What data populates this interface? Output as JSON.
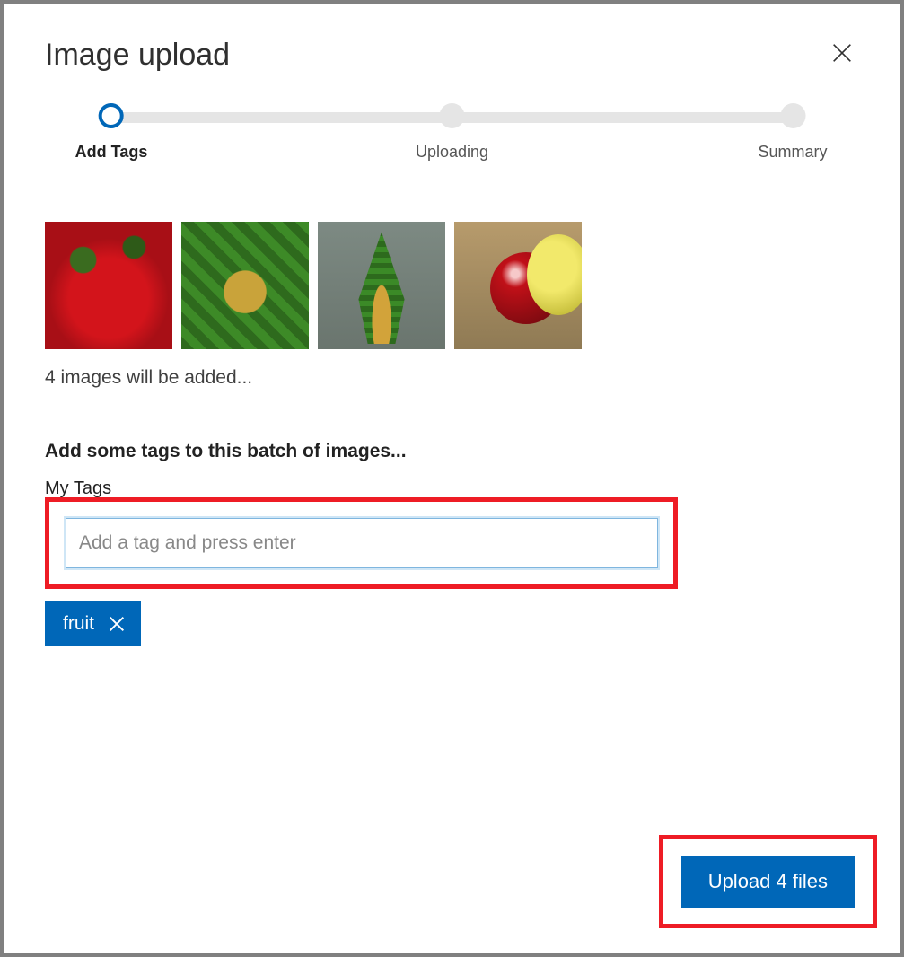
{
  "dialog": {
    "title": "Image upload"
  },
  "stepper": {
    "steps": [
      {
        "label": "Add Tags",
        "active": true
      },
      {
        "label": "Uploading",
        "active": false
      },
      {
        "label": "Summary",
        "active": false
      }
    ]
  },
  "thumbnails": {
    "count": 4,
    "status_text": "4 images will be added..."
  },
  "tags_section": {
    "heading": "Add some tags to this batch of images...",
    "field_label": "My Tags",
    "placeholder": "Add a tag and press enter",
    "value": "",
    "chips": [
      {
        "label": "fruit"
      }
    ]
  },
  "footer": {
    "upload_label": "Upload 4 files"
  }
}
